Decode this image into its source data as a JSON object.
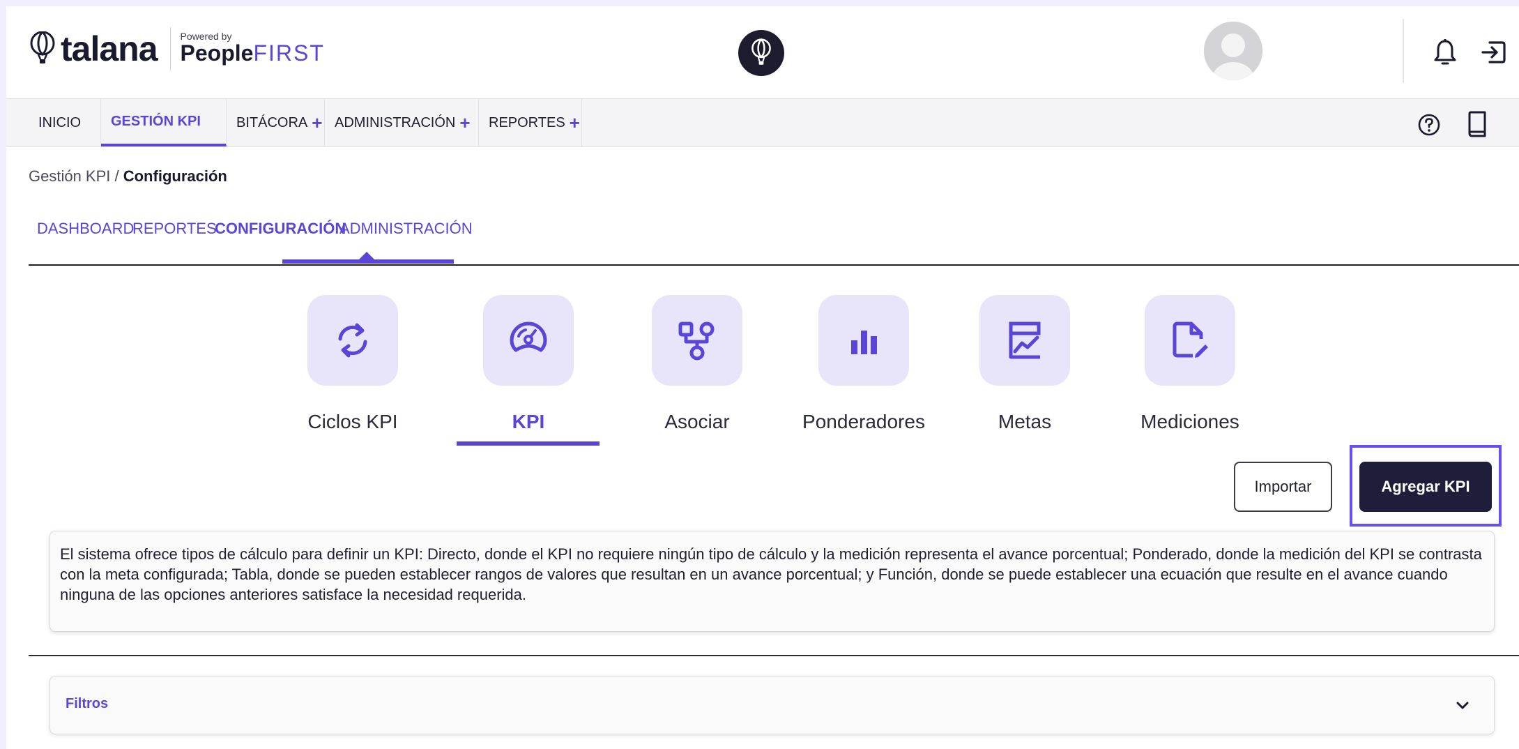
{
  "header": {
    "logo_word": "talana",
    "powered_label": "Powered by",
    "brand_people": "People",
    "brand_first": "FIRST"
  },
  "nav": {
    "items": [
      {
        "label": "INICIO"
      },
      {
        "label": "GESTIÓN KPI"
      },
      {
        "label": "BITÁCORA",
        "plus": "+"
      },
      {
        "label": "ADMINISTRACIÓN",
        "plus": "+"
      },
      {
        "label": "REPORTES",
        "plus": "+"
      }
    ],
    "active": "GESTIÓN KPI"
  },
  "breadcrumb": {
    "parent": "Gestión KPI",
    "separator": " / ",
    "current": "Configuración"
  },
  "subtabs": {
    "items": [
      {
        "label": "DASHBOARD"
      },
      {
        "label": "REPORTES"
      },
      {
        "label": "CONFIGURACIÓN"
      },
      {
        "label": "ADMINISTRACIÓN"
      }
    ],
    "active": "CONFIGURACIÓN"
  },
  "modules": {
    "items": [
      {
        "label": "Ciclos KPI",
        "icon": "cycle-icon"
      },
      {
        "label": "KPI",
        "icon": "gauge-icon"
      },
      {
        "label": "Asociar",
        "icon": "hierarchy-icon"
      },
      {
        "label": "Ponderadores",
        "icon": "bar-chart-icon"
      },
      {
        "label": "Metas",
        "icon": "trend-icon"
      },
      {
        "label": "Mediciones",
        "icon": "file-edit-icon"
      }
    ],
    "active": "KPI"
  },
  "actions": {
    "import_label": "Importar",
    "add_label": "Agregar KPI"
  },
  "info": {
    "text": "El sistema ofrece tipos de cálculo para definir un KPI: Directo, donde el KPI no requiere ningún tipo de cálculo y la medición representa el avance porcentual; Ponderado, donde la medición del KPI se contrasta con la meta configurada; Tabla, donde se pueden establecer rangos de valores que resultan en un avance porcentual; y Función, donde se puede establecer una ecuación que resulte en el avance cuando ninguna de las opciones anteriores satisface la necesidad requerida."
  },
  "filters": {
    "label": "Filtros"
  },
  "colors": {
    "accent": "#5a46d6",
    "primary_button": "#1e1e3a",
    "tile_bg": "#e8e5fb",
    "highlight": "#6a4ff0"
  }
}
